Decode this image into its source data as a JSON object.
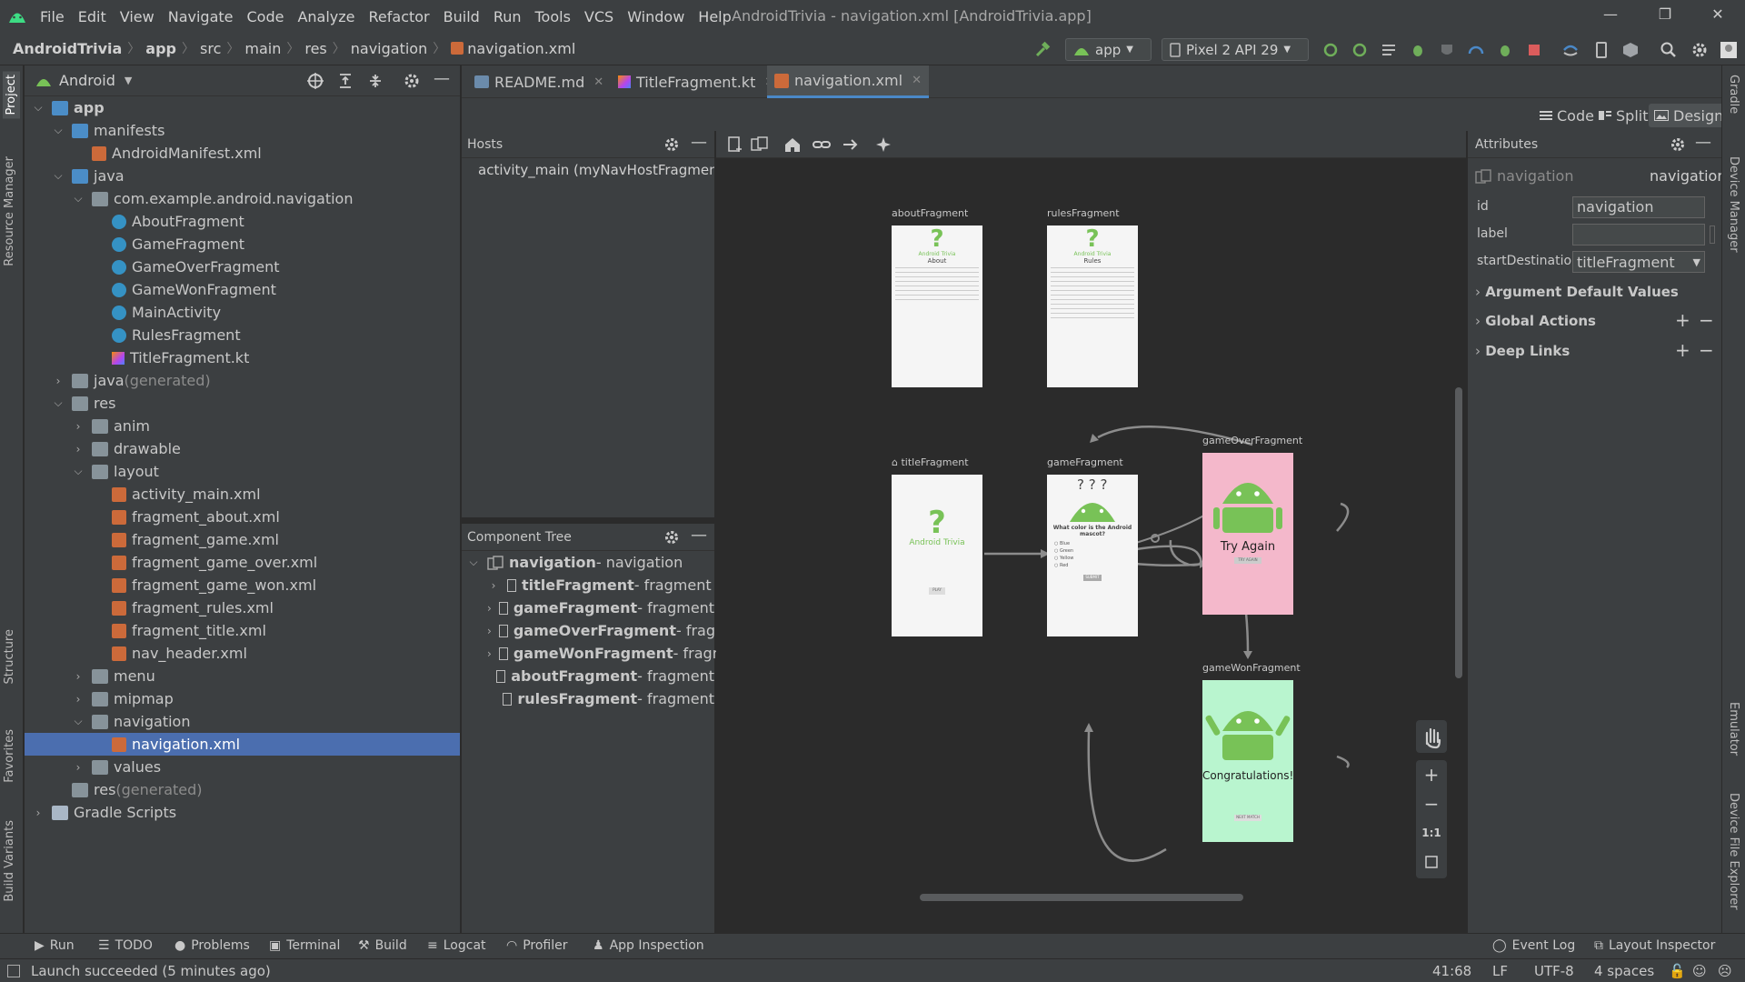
{
  "window": {
    "title": "AndroidTrivia - navigation.xml [AndroidTrivia.app]",
    "menu": [
      "File",
      "Edit",
      "View",
      "Navigate",
      "Code",
      "Analyze",
      "Refactor",
      "Build",
      "Run",
      "Tools",
      "VCS",
      "Window",
      "Help"
    ]
  },
  "breadcrumb": [
    "AndroidTrivia",
    "app",
    "src",
    "main",
    "res",
    "navigation",
    "navigation.xml"
  ],
  "toolbar": {
    "run_config": "app",
    "device": "Pixel 2 API 29"
  },
  "project_panel": {
    "title": "Android",
    "tree": [
      {
        "label": "app",
        "level": 0,
        "icon": "module",
        "expanded": true,
        "bold": true
      },
      {
        "label": "manifests",
        "level": 1,
        "icon": "folder-blue",
        "expanded": true
      },
      {
        "label": "AndroidManifest.xml",
        "level": 2,
        "icon": "manifest"
      },
      {
        "label": "java",
        "level": 1,
        "icon": "folder-blue",
        "expanded": true
      },
      {
        "label": "com.example.android.navigation",
        "level": 2,
        "icon": "package",
        "expanded": true
      },
      {
        "label": "AboutFragment",
        "level": 3,
        "icon": "kotlin-class"
      },
      {
        "label": "GameFragment",
        "level": 3,
        "icon": "kotlin-class"
      },
      {
        "label": "GameOverFragment",
        "level": 3,
        "icon": "kotlin-class"
      },
      {
        "label": "GameWonFragment",
        "level": 3,
        "icon": "kotlin-class"
      },
      {
        "label": "MainActivity",
        "level": 3,
        "icon": "kotlin-class"
      },
      {
        "label": "RulesFragment",
        "level": 3,
        "icon": "kotlin-class"
      },
      {
        "label": "TitleFragment.kt",
        "level": 3,
        "icon": "kotlin-file"
      },
      {
        "label": "java",
        "suffix": " (generated)",
        "level": 1,
        "icon": "folder-gen",
        "collapsed": true
      },
      {
        "label": "res",
        "level": 1,
        "icon": "folder-res",
        "expanded": true
      },
      {
        "label": "anim",
        "level": 2,
        "icon": "folder",
        "collapsed": true
      },
      {
        "label": "drawable",
        "level": 2,
        "icon": "folder",
        "collapsed": true
      },
      {
        "label": "layout",
        "level": 2,
        "icon": "folder",
        "expanded": true
      },
      {
        "label": "activity_main.xml",
        "level": 3,
        "icon": "layout-xml"
      },
      {
        "label": "fragment_about.xml",
        "level": 3,
        "icon": "layout-xml"
      },
      {
        "label": "fragment_game.xml",
        "level": 3,
        "icon": "layout-xml"
      },
      {
        "label": "fragment_game_over.xml",
        "level": 3,
        "icon": "layout-xml"
      },
      {
        "label": "fragment_game_won.xml",
        "level": 3,
        "icon": "layout-xml"
      },
      {
        "label": "fragment_rules.xml",
        "level": 3,
        "icon": "layout-xml"
      },
      {
        "label": "fragment_title.xml",
        "level": 3,
        "icon": "layout-xml"
      },
      {
        "label": "nav_header.xml",
        "level": 3,
        "icon": "layout-xml"
      },
      {
        "label": "menu",
        "level": 2,
        "icon": "folder",
        "collapsed": true
      },
      {
        "label": "mipmap",
        "level": 2,
        "icon": "folder",
        "collapsed": true
      },
      {
        "label": "navigation",
        "level": 2,
        "icon": "folder",
        "expanded": true
      },
      {
        "label": "navigation.xml",
        "level": 3,
        "icon": "nav-xml",
        "selected": true
      },
      {
        "label": "values",
        "level": 2,
        "icon": "folder",
        "collapsed": true
      },
      {
        "label": "res",
        "suffix": " (generated)",
        "level": 1,
        "icon": "folder-gen"
      },
      {
        "label": "Gradle Scripts",
        "level": 0,
        "icon": "gradle",
        "collapsed": true
      }
    ]
  },
  "tabs": [
    {
      "label": "README.md",
      "active": false
    },
    {
      "label": "TitleFragment.kt",
      "active": false
    },
    {
      "label": "navigation.xml",
      "active": true
    }
  ],
  "view_modes": [
    "Code",
    "Split",
    "Design"
  ],
  "hosts": {
    "title": "Hosts",
    "item": "activity_main (myNavHostFragmen"
  },
  "component_tree": {
    "title": "Component Tree",
    "root": {
      "name": "navigation",
      "type": " - navigation"
    },
    "items": [
      {
        "name": "titleFragment",
        "type": " - fragment",
        "expandable": true
      },
      {
        "name": "gameFragment",
        "type": " - fragment",
        "expandable": true
      },
      {
        "name": "gameOverFragment",
        "type": " - fragm",
        "expandable": true
      },
      {
        "name": "gameWonFragment",
        "type": " - fragm",
        "expandable": true
      },
      {
        "name": "aboutFragment",
        "type": " - fragment",
        "expandable": false
      },
      {
        "name": "rulesFragment",
        "type": " - fragment",
        "expandable": false
      }
    ]
  },
  "graph": {
    "fragments": {
      "about": {
        "label": "aboutFragment",
        "app": "Android Trivia",
        "heading": "About"
      },
      "rules": {
        "label": "rulesFragment",
        "app": "Android Trivia",
        "heading": "Rules"
      },
      "title": {
        "label": "titleFragment",
        "app": "Android Trivia",
        "button": "PLAY"
      },
      "game": {
        "label": "gameFragment",
        "question": "What color is the Android mascot?",
        "options": [
          "Blue",
          "Green",
          "Yellow",
          "Red"
        ],
        "button": "SUBMIT"
      },
      "gameover": {
        "label": "gameOverFragment",
        "text": "Try Again",
        "button": "TRY AGAIN",
        "bg": "#f4b8cb"
      },
      "gamewon": {
        "label": "gameWonFragment",
        "text": "Congratulations!",
        "button": "NEXT MATCH",
        "bg": "#b9f5cf"
      }
    },
    "zoom_fit": "1:1"
  },
  "attributes": {
    "title": "Attributes",
    "element_type": "navigation",
    "element_name": "navigation",
    "id_label": "id",
    "id_value": "navigation",
    "label_label": "label",
    "label_value": "",
    "start_label": "startDestination",
    "start_value": "titleFragment",
    "sections": [
      "Argument Default Values",
      "Global Actions",
      "Deep Links"
    ]
  },
  "tool_windows": {
    "left": [
      "Project",
      "Resource Manager",
      "Structure",
      "Favorites",
      "Build Variants"
    ],
    "right": [
      "Gradle",
      "Device Manager",
      "Emulator",
      "Device File Explorer"
    ],
    "bottom": [
      "Run",
      "TODO",
      "Problems",
      "Terminal",
      "Build",
      "Logcat",
      "Profiler",
      "App Inspection"
    ],
    "bottom_right": [
      "Event Log",
      "Layout Inspector"
    ]
  },
  "status": {
    "message": "Launch succeeded (5 minutes ago)",
    "position": "41:68",
    "line_sep": "LF",
    "encoding": "UTF-8",
    "indent": "4 spaces"
  },
  "colors": {
    "accent": "#4a88c7",
    "selection": "#4b6eaf",
    "android_green": "#78c257"
  }
}
